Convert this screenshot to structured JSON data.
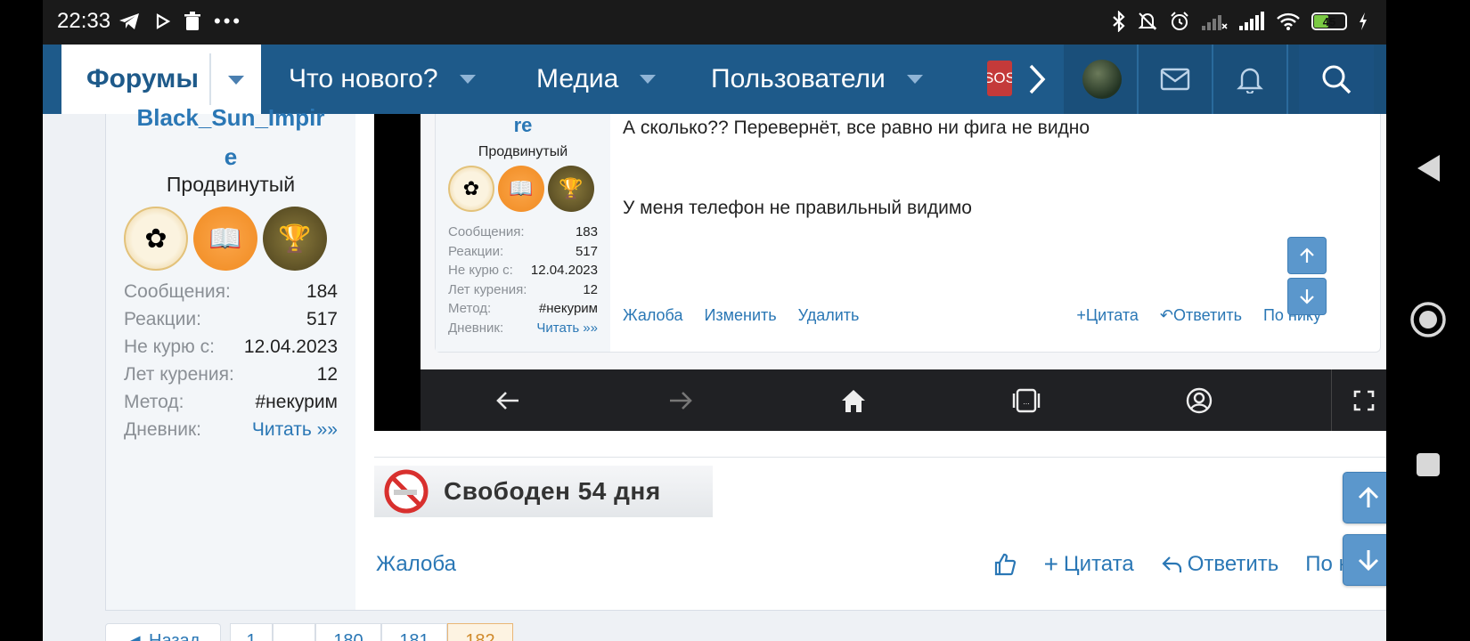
{
  "status_bar": {
    "time": "22:33",
    "battery_level": "45"
  },
  "nav": {
    "tabs": [
      {
        "label": "Форумы",
        "active": true
      },
      {
        "label": "Что нового?"
      },
      {
        "label": "Медиа"
      },
      {
        "label": "Пользователи"
      }
    ],
    "sos_label": "SOS"
  },
  "post": {
    "author": {
      "username_line1": "Black_Sun_Impir",
      "username_line2": "e",
      "rank": "Продвинутый",
      "stats": [
        {
          "key": "Сообщения:",
          "value": "184"
        },
        {
          "key": "Реакции:",
          "value": "517"
        },
        {
          "key": "Не курю с:",
          "value": "12.04.2023"
        },
        {
          "key": "Лет курения:",
          "value": "12"
        },
        {
          "key": "Метод:",
          "value": "#некурим"
        },
        {
          "key": "Дневник:",
          "value": "Читать »»"
        }
      ]
    },
    "signature_text": "Свободен 54 дня",
    "actions": {
      "report": "Жалоба",
      "quote": "Цитата",
      "reply": "Ответить",
      "by_nick": "По нику"
    }
  },
  "embedded": {
    "username": "re",
    "rank": "Продвинутый",
    "stats": [
      {
        "key": "Сообщения:",
        "value": "183"
      },
      {
        "key": "Реакции:",
        "value": "517"
      },
      {
        "key": "Не курю с:",
        "value": "12.04.2023"
      },
      {
        "key": "Лет курения:",
        "value": "12"
      },
      {
        "key": "Метод:",
        "value": "#некурим"
      },
      {
        "key": "Дневник:",
        "value": "Читать »»"
      }
    ],
    "text_line1": "А сколько?? Перевернёт, все равно ни фига не видно",
    "text_line2": "У меня телефон не правильный видимо",
    "actions": {
      "report": "Жалоба",
      "edit": "Изменить",
      "delete": "Удалить",
      "quote": "Цитата",
      "reply": "Ответить",
      "by_nick": "По нику"
    }
  },
  "pagination": {
    "prev": "◄ Назад",
    "pages": [
      "1",
      "…",
      "180",
      "181",
      "182"
    ],
    "current": "182"
  },
  "colors": {
    "nav_bg": "#1e5a8a",
    "link": "#2a77b5",
    "float_button": "#5b97cc"
  }
}
